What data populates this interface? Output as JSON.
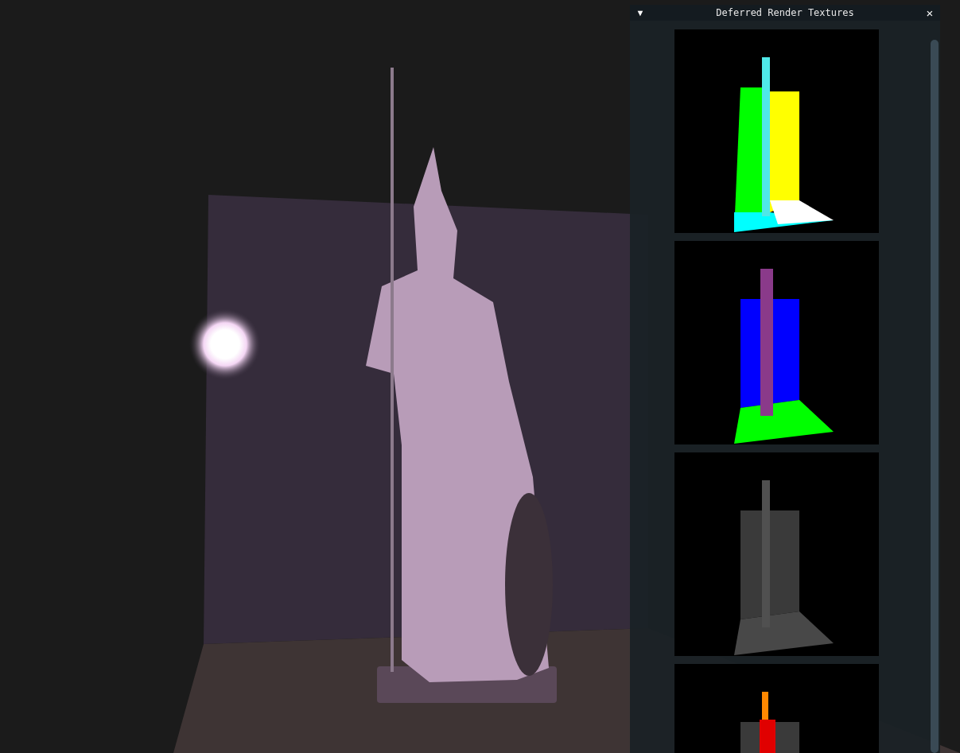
{
  "panel": {
    "collapse_glyph": "▼",
    "title": "Deferred Render Textures",
    "close_glyph": "×"
  }
}
